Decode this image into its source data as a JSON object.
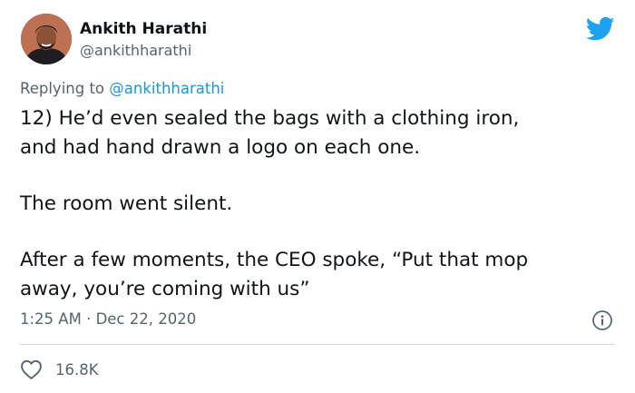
{
  "author": {
    "name": "Ankith Harathi",
    "handle": "@ankithharathi"
  },
  "reply": {
    "prefix": "Replying to",
    "mention": "@ankithharathi"
  },
  "tweet": {
    "line1": "12) He’d even sealed the bags with a clothing iron,",
    "line2": "and had hand drawn a logo on each one.",
    "line3": "The room went silent.",
    "line4": "After a few moments, the CEO spoke, “Put that mop",
    "line5": "away, you’re coming with us”"
  },
  "meta": {
    "time": "1:25 AM",
    "separator": "·",
    "date": "Dec 22, 2020"
  },
  "likes": {
    "count": "16.8K"
  },
  "colors": {
    "twitter_blue": "#1da1f2",
    "mention_blue": "#1b95e0",
    "secondary_text": "#536471",
    "divider": "#cfd9de"
  },
  "icons": {
    "brand": "twitter-bird-icon",
    "info": "info-icon",
    "like": "heart-icon"
  }
}
